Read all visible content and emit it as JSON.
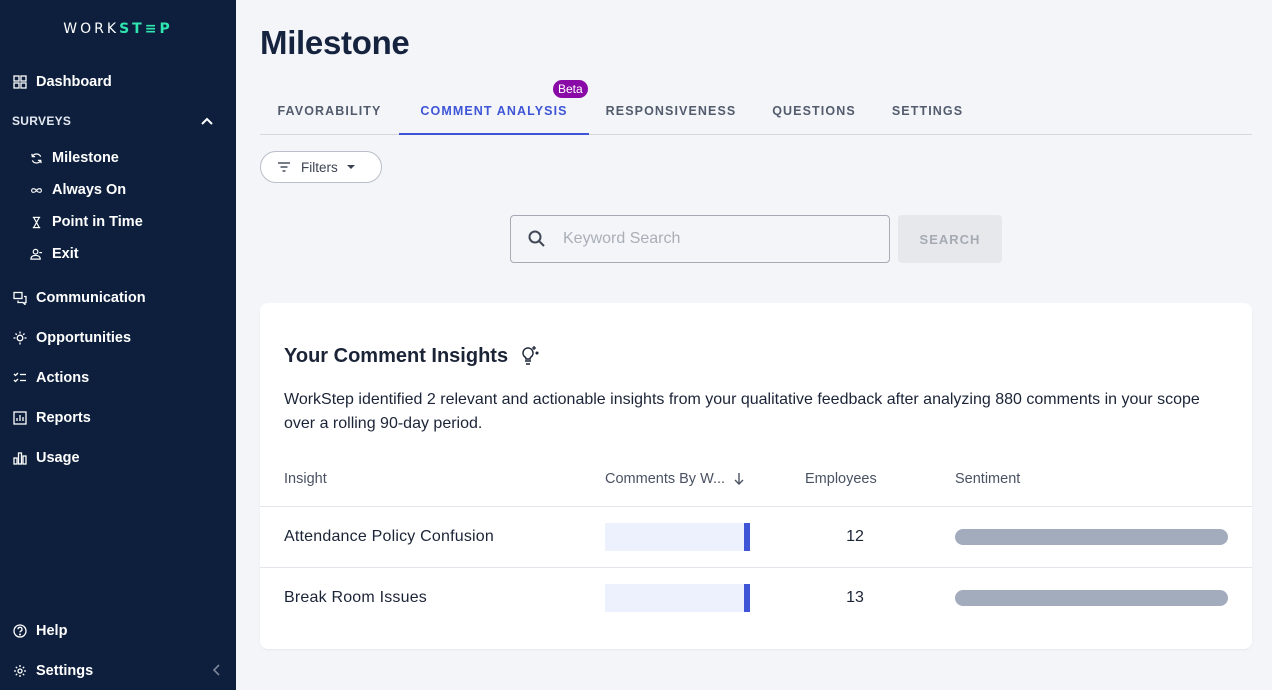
{
  "sidebar": {
    "logo_left": "WORK",
    "logo_accent": "ST≡P",
    "dashboard": "Dashboard",
    "surveys_label": "SURVEYS",
    "survey_items": [
      "Milestone",
      "Always On",
      "Point in Time",
      "Exit"
    ],
    "communication": "Communication",
    "opportunities": "Opportunities",
    "actions": "Actions",
    "reports": "Reports",
    "usage": "Usage",
    "help": "Help",
    "settings": "Settings"
  },
  "page": {
    "title": "Milestone"
  },
  "tabs": {
    "favorability": "FAVORABILITY",
    "comment_analysis": "COMMENT ANALYSIS",
    "responsiveness": "RESPONSIVENESS",
    "questions": "QUESTIONS",
    "settings": "SETTINGS",
    "beta": "Beta",
    "active": "COMMENT ANALYSIS"
  },
  "filters": {
    "label": "Filters"
  },
  "search": {
    "placeholder": "Keyword Search",
    "button": "SEARCH"
  },
  "insights": {
    "title": "Your Comment Insights",
    "description": "WorkStep identified 2 relevant and actionable insights from your qualitative feedback after analyzing 880 comments in your scope over a rolling 90-day period.",
    "columns": {
      "insight": "Insight",
      "comments": "Comments By W...",
      "employees": "Employees",
      "sentiment": "Sentiment"
    },
    "rows": [
      {
        "name": "Attendance Policy Confusion",
        "employees": "12"
      },
      {
        "name": "Break Room Issues",
        "employees": "13"
      }
    ]
  },
  "colors": {
    "sidebar_bg": "#0d1f3c",
    "accent": "#3d55d6",
    "beta_badge": "#8a0aa8",
    "logo_accent": "#2ee6b0"
  }
}
